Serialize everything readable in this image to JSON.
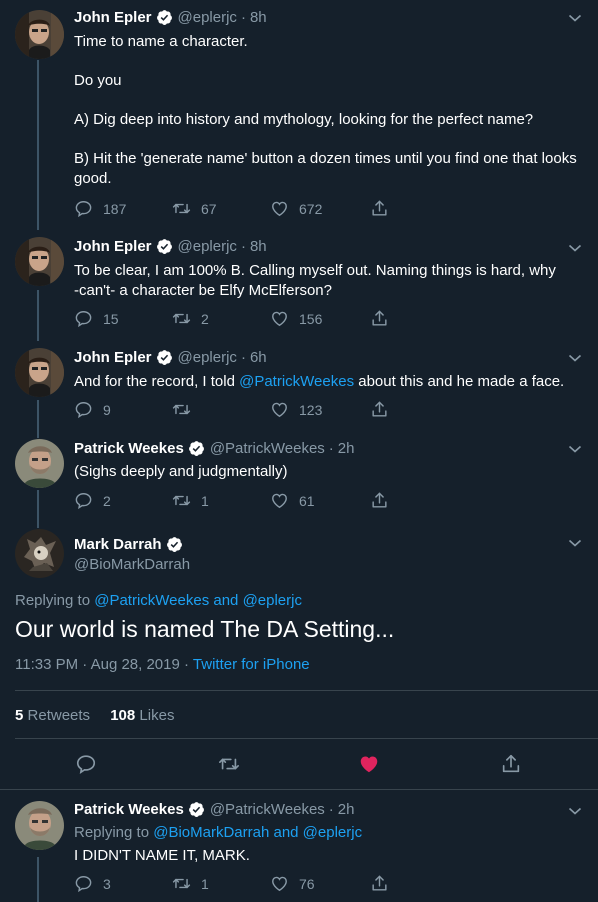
{
  "tweets": [
    {
      "name": "John Epler",
      "handle": "@eplerjc",
      "time": "8h",
      "lines": [
        "Time to name a character.",
        "",
        "Do you",
        "",
        "A) Dig deep into history and mythology, looking for the perfect name?",
        "",
        "B) Hit the 'generate name' button a dozen times until you find one that looks",
        "good."
      ],
      "replies": "187",
      "retweets": "67",
      "likes": "672"
    },
    {
      "name": "John Epler",
      "handle": "@eplerjc",
      "time": "8h",
      "lines": [
        "To be clear, I am 100% B. Calling myself out. Naming things is hard, why",
        "-can't- a character be Elfy McElferson?"
      ],
      "replies": "15",
      "retweets": "2",
      "likes": "156"
    },
    {
      "name": "John Epler",
      "handle": "@eplerjc",
      "time": "6h",
      "text_before": "And for the record, I told ",
      "mention": "@PatrickWeekes",
      "text_after": " about this and he made a face.",
      "replies": "9",
      "retweets": "",
      "likes": "123"
    },
    {
      "name": "Patrick Weekes",
      "handle": "@PatrickWeekes",
      "time": "2h",
      "text": "(Sighs deeply and judgmentally)",
      "replies": "2",
      "retweets": "1",
      "likes": "61"
    }
  ],
  "main_tweet": {
    "name": "Mark Darrah",
    "handle": "@BioMarkDarrah",
    "replying_label": "Replying to ",
    "replying_to": "@PatrickWeekes and @eplerjc",
    "text": "Our world is named The DA Setting...",
    "timestamp": "11:33 PM · Aug 28, 2019 · ",
    "source": "Twitter for iPhone",
    "retweet_count": "5",
    "retweet_label": "Retweets",
    "like_count": "108",
    "like_label": "Likes"
  },
  "reply_tweet": {
    "name": "Patrick Weekes",
    "handle": "@PatrickWeekes",
    "time": "2h",
    "replying_label": "Replying to ",
    "replying_to": "@BioMarkDarrah and @eplerjc",
    "text": "I DIDN'T NAME IT, MARK.",
    "replies": "3",
    "retweets": "1",
    "likes": "76"
  },
  "colors": {
    "background": "#15202b",
    "accent": "#1da1f2",
    "muted": "#8899a6",
    "like_active": "#e0245e",
    "divider": "#38444d"
  }
}
